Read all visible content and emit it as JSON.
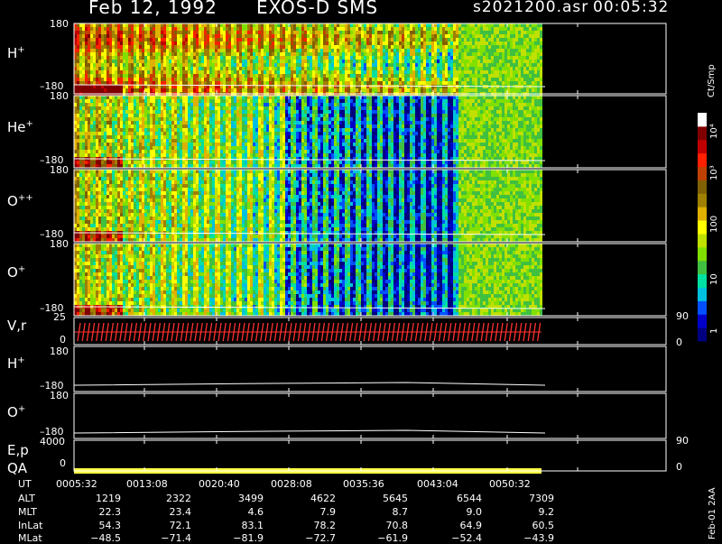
{
  "header": {
    "date": "Feb 12, 1992",
    "mission": "EXOS-D SMS",
    "file": "s2021200.asr",
    "time": "00:05:32"
  },
  "panels": [
    {
      "label": "H",
      "sup": "+",
      "ytop": "180",
      "ybot": "–180"
    },
    {
      "label": "He",
      "sup": "+",
      "ytop": "180",
      "ybot": "–180"
    },
    {
      "label": "O",
      "sup": "++",
      "ytop": "180",
      "ybot": "–180"
    },
    {
      "label": "O",
      "sup": "+",
      "ytop": "180",
      "ybot": "–180"
    },
    {
      "label": "V,r",
      "sup": "",
      "ytop": "25",
      "ybot": "0",
      "rtop": "90",
      "rbot": "0"
    },
    {
      "label": "H",
      "sup": "+",
      "ytop": "180",
      "ybot": "–180"
    },
    {
      "label": "O",
      "sup": "+",
      "ytop": "180",
      "ybot": "–180"
    },
    {
      "label": "E,p",
      "sup": "",
      "ytop": "4000",
      "rtop": "90"
    },
    {
      "label": "QA",
      "sup": "",
      "ybot": "0",
      "rbot": "0"
    }
  ],
  "colorbar": {
    "unit": "Ct/Smp",
    "ticks": [
      "10⁴",
      "10³",
      "100",
      "10",
      "1"
    ]
  },
  "footer": {
    "row_labels": [
      "UT",
      "ALT",
      "MLT",
      "InLat",
      "MLat"
    ],
    "columns": [
      [
        "0005:32",
        "1219",
        "22.3",
        "54.3",
        "−48.5"
      ],
      [
        "0013:08",
        "2322",
        "23.4",
        "72.1",
        "−71.4"
      ],
      [
        "0020:40",
        "3499",
        "4.6",
        "83.1",
        "−81.9"
      ],
      [
        "0028:08",
        "4622",
        "7.9",
        "78.2",
        "−72.7"
      ],
      [
        "0035:36",
        "5645",
        "8.7",
        "70.8",
        "−61.9"
      ],
      [
        "0043:04",
        "6544",
        "9.0",
        "64.9",
        "−52.4"
      ],
      [
        "0050:32",
        "7309",
        "9.2",
        "60.5",
        "−43.9"
      ]
    ],
    "stamp": "Feb-01 2AA"
  },
  "colors": {
    "scale": [
      "#000080",
      "#0000c8",
      "#0050ff",
      "#00c0e0",
      "#00e0a0",
      "#40c040",
      "#80e000",
      "#c0e000",
      "#ffff00",
      "#e0b000",
      "#a08000",
      "#806000",
      "#c04000",
      "#ff2000",
      "#c00000",
      "#800000",
      "#ffffff"
    ],
    "qa_bar": "#ffff40",
    "vel_marks": "#ff3030"
  },
  "chart_data": {
    "type": "heatmap",
    "title": "Feb 12, 1992   EXOS-D SMS",
    "x": [
      "0005:32",
      "0013:08",
      "0020:40",
      "0028:08",
      "0035:36",
      "0043:04",
      "0050:32"
    ],
    "series": [
      {
        "name": "H+",
        "ylim": [
          -180,
          180
        ]
      },
      {
        "name": "He+",
        "ylim": [
          -180,
          180
        ]
      },
      {
        "name": "O++",
        "ylim": [
          -180,
          180
        ]
      },
      {
        "name": "O+",
        "ylim": [
          -180,
          180
        ]
      }
    ],
    "colorbar_unit": "Ct/Smp",
    "colorbar_range": [
      1,
      10000
    ],
    "colorbar_scale": "log"
  }
}
